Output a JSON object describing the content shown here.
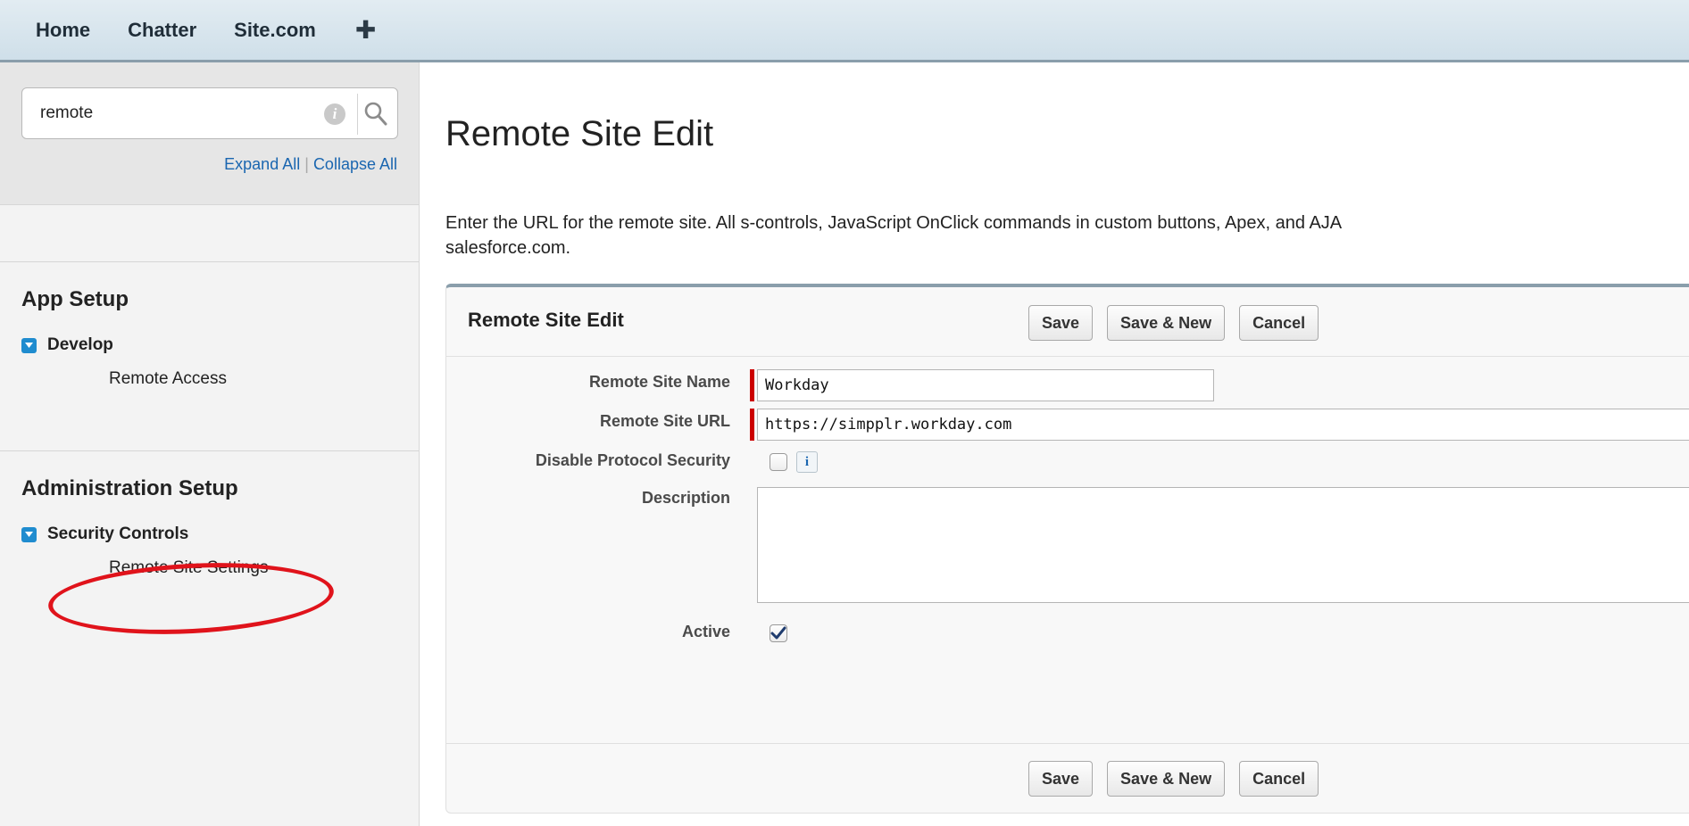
{
  "topnav": {
    "items": [
      "Home",
      "Chatter",
      "Site.com"
    ],
    "add_tab_icon": "plus-icon"
  },
  "sidebar": {
    "search": {
      "value": "remote",
      "info_icon": "info-icon",
      "search_icon": "magnifier-icon"
    },
    "expand_all": "Expand All",
    "separator": "|",
    "collapse_all": "Collapse All",
    "sections": [
      {
        "title": "App Setup",
        "node": "Develop",
        "leaf": "Remote Access"
      },
      {
        "title": "Administration Setup",
        "node": "Security Controls",
        "leaf": "Remote Site Settings"
      }
    ],
    "highlight_color": "#e0131b"
  },
  "main": {
    "title": "Remote Site Edit",
    "description_line1": "Enter the URL for the remote site. All s-controls, JavaScript OnClick commands in custom buttons, Apex, and AJA",
    "description_line2": "salesforce.com.",
    "panel": {
      "title": "Remote Site Edit",
      "buttons": {
        "save": "Save",
        "save_new": "Save & New",
        "cancel": "Cancel"
      },
      "fields": {
        "name_label": "Remote Site Name",
        "name_value": "Workday",
        "url_label": "Remote Site URL",
        "url_value": "https://simpplr.workday.com",
        "disable_label": "Disable Protocol Security",
        "disable_checked": false,
        "help_badge": "i",
        "description_label": "Description",
        "description_value": "",
        "active_label": "Active",
        "active_checked": true
      }
    }
  },
  "colors": {
    "accent": "#1f8ccf",
    "link": "#1a66b0",
    "required": "#cc0000",
    "header_border": "#8a9eab"
  }
}
